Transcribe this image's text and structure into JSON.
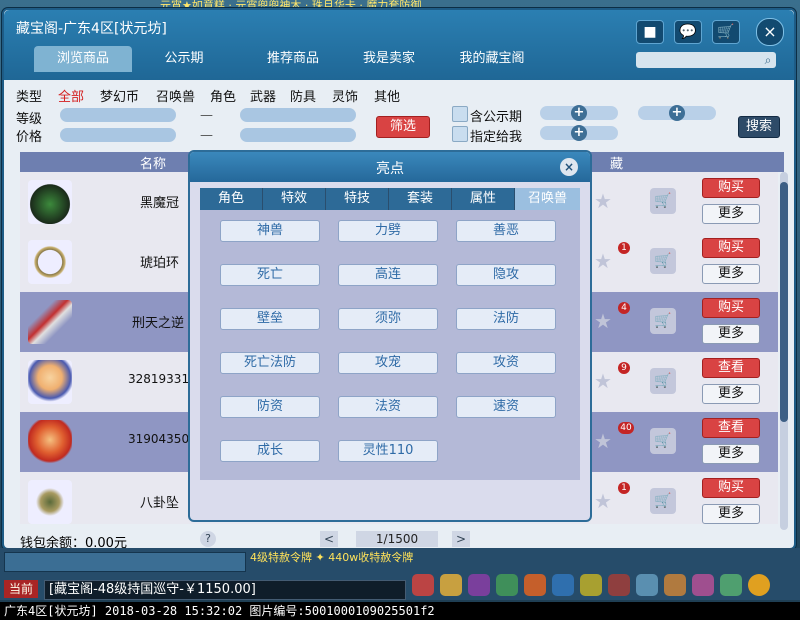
{
  "window": {
    "title": "藏宝阁-广东4区[状元坊]",
    "tabs": [
      "浏览商品",
      "公示期",
      "推荐商品",
      "我是卖家",
      "我的藏宝阁"
    ],
    "active_tab": 0
  },
  "categories": {
    "type_label": "类型",
    "items": [
      "全部",
      "梦幻币",
      "召唤兽",
      "角色",
      "武器",
      "防具",
      "灵饰",
      "其他"
    ],
    "selected": 0
  },
  "filters": {
    "level_label": "等级",
    "price_label": "价格",
    "dash": "—",
    "filter_button": "筛选",
    "in_public_label": "含公示期",
    "assigned_label": "指定给我",
    "search_button": "搜索"
  },
  "table": {
    "col_name": "名称",
    "col_fav": "藏",
    "rows": [
      {
        "name": "黑魔冠",
        "badge": "",
        "action": "购买",
        "more": "更多",
        "style": "light"
      },
      {
        "name": "琥珀环",
        "badge": "1",
        "action": "购买",
        "more": "更多",
        "style": "light"
      },
      {
        "name": "刑天之逆",
        "badge": "4",
        "action": "购买",
        "more": "更多",
        "style": "dark"
      },
      {
        "name": "32819331",
        "badge": "9",
        "action": "查看",
        "more": "更多",
        "style": "light"
      },
      {
        "name": "31904350",
        "badge": "40",
        "action": "查看",
        "more": "更多",
        "style": "dark"
      },
      {
        "name": "八卦坠",
        "badge": "1",
        "action": "购买",
        "more": "更多",
        "style": "light"
      }
    ]
  },
  "footer": {
    "wallet": "钱包余额：0.00元",
    "help": "?",
    "prev": "<",
    "page": "1/1500",
    "next": ">"
  },
  "dialog": {
    "title": "亮点",
    "close": "×",
    "tabs": [
      "角色",
      "特效",
      "特技",
      "套装",
      "属性",
      "召唤兽"
    ],
    "selected_tab": 5,
    "options": [
      "神兽",
      "力劈",
      "善恶",
      "死亡",
      "高连",
      "隐攻",
      "壁垒",
      "须弥",
      "法防",
      "死亡法防",
      "攻宠",
      "攻资",
      "防资",
      "法资",
      "速资",
      "成长",
      "灵性110"
    ]
  },
  "game": {
    "marquee": "元宵★如意糕 · 元宵兜兜神木 · 珠月华卡 · 魔力套防御",
    "hotbar_text": "4级特赦令牌 ✦ 440w收特赦令牌",
    "chat_button": "当前",
    "chat_line": "[藏宝阁-48级持国巡守-￥1150.00]",
    "status": "广东4区[状元坊] 2018-03-28 15:32:02 图片编号:5001000109025501f2"
  },
  "colors": {
    "accent": "#1f6796",
    "buy_red": "#d94343",
    "selected_category": "#d42020"
  },
  "icons": {
    "window_buttons": [
      "stop-icon",
      "chat-icon",
      "cart-icon"
    ],
    "plus": "+",
    "star": "★",
    "cart": "🛒",
    "search": "⌕"
  }
}
